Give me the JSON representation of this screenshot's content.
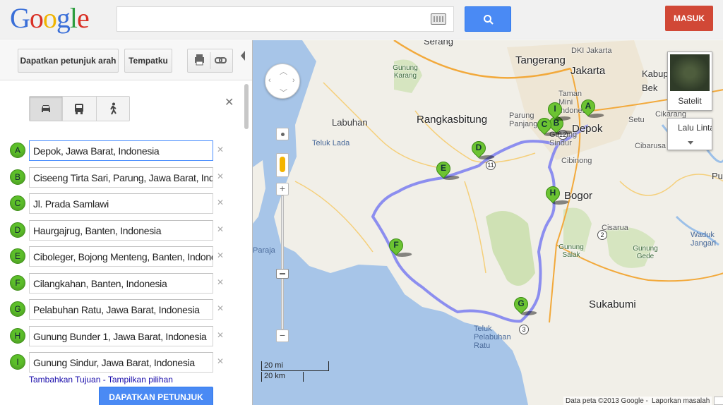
{
  "header": {
    "logo_letters": [
      {
        "ch": "G",
        "color": "#3a6fd8"
      },
      {
        "ch": "o",
        "color": "#d93025"
      },
      {
        "ch": "o",
        "color": "#f0b400"
      },
      {
        "ch": "g",
        "color": "#3a6fd8"
      },
      {
        "ch": "l",
        "color": "#2d9d3f"
      },
      {
        "ch": "e",
        "color": "#d93025"
      }
    ],
    "search_value": "",
    "signin_label": "MASUK"
  },
  "panel": {
    "directions_label": "Dapatkan petunjuk arah",
    "myplaces_label": "Tempatku",
    "print_icon": "print-icon",
    "link_icon": "link-icon",
    "travel_modes": [
      "car-icon",
      "transit-icon",
      "walk-icon"
    ],
    "waypoints": [
      {
        "letter": "A",
        "value": "Depok, Jawa Barat, Indonesia"
      },
      {
        "letter": "B",
        "value": "Ciseeng Tirta Sari, Parung, Jawa Barat, Indonesia"
      },
      {
        "letter": "C",
        "value": "Jl. Prada Samlawi"
      },
      {
        "letter": "D",
        "value": "Haurgajrug, Banten, Indonesia"
      },
      {
        "letter": "E",
        "value": "Ciboleger, Bojong Menteng, Banten, Indonesia"
      },
      {
        "letter": "F",
        "value": "Cilangkahan, Banten, Indonesia"
      },
      {
        "letter": "G",
        "value": "Pelabuhan Ratu, Jawa Barat, Indonesia"
      },
      {
        "letter": "H",
        "value": "Gunung Bunder 1, Jawa Barat, Indonesia"
      },
      {
        "letter": "I",
        "value": "Gunung Sindur, Jawa Barat, Indonesia"
      }
    ],
    "add_destination": "Tambahkan Tujuan",
    "link_separator": " - ",
    "show_options": "Tampilkan pilihan",
    "get_directions_button": "DAPATKAN PETUNJUK ARAH"
  },
  "map": {
    "labels": [
      {
        "text": "Serang",
        "cls": "lbl"
      },
      {
        "text": "Tangerang",
        "cls": "lbl big"
      },
      {
        "text": "DKI Jakarta",
        "cls": "lbl sm"
      },
      {
        "text": "Jakarta",
        "cls": "lbl big"
      },
      {
        "text": "Kabup",
        "cls": "lbl"
      },
      {
        "text": "Bek",
        "cls": "lbl"
      },
      {
        "text": "Gunung Karang",
        "cls": "lbl park"
      },
      {
        "text": "Taman Mini Indonesia",
        "cls": "lbl sm"
      },
      {
        "text": "Labuhan",
        "cls": "lbl"
      },
      {
        "text": "Rangkasbitung",
        "cls": "lbl big"
      },
      {
        "text": "Parung Panjang",
        "cls": "lbl sm"
      },
      {
        "text": "Depok",
        "cls": "lbl big"
      },
      {
        "text": "Setu",
        "cls": "lbl sm"
      },
      {
        "text": "Cikarang",
        "cls": "lbl sm"
      },
      {
        "text": "Teluk Lada",
        "cls": "lbl water"
      },
      {
        "text": "Gunung Sindur",
        "cls": "lbl sm"
      },
      {
        "text": "Cibarusa",
        "cls": "lbl sm"
      },
      {
        "text": "Cibinong",
        "cls": "lbl sm"
      },
      {
        "text": "Bogor",
        "cls": "lbl big"
      },
      {
        "text": "Pu",
        "cls": "lbl"
      },
      {
        "text": "Cisarua",
        "cls": "lbl sm"
      },
      {
        "text": "Gunung Salak",
        "cls": "lbl park"
      },
      {
        "text": "Gunung Gede",
        "cls": "lbl park"
      },
      {
        "text": "Waduk Jangari",
        "cls": "lbl water"
      },
      {
        "text": "Paraja",
        "cls": "lbl water"
      },
      {
        "text": "Sukabumi",
        "cls": "lbl big"
      },
      {
        "text": "Teluk Pelabuhan Ratu",
        "cls": "lbl water"
      }
    ],
    "route_shields": [
      "12",
      "11",
      "3",
      "2"
    ],
    "pins": [
      "A",
      "B",
      "C",
      "D",
      "E",
      "F",
      "G",
      "H",
      "I"
    ],
    "satellite_label": "Satelit",
    "traffic_label": "Lalu Lintas",
    "scale_mi": "20 mi",
    "scale_km": "20 km",
    "attribution": "Data peta ©2013 Google",
    "attribution_sep": " - ",
    "report_problem": "Laporkan masalah"
  }
}
